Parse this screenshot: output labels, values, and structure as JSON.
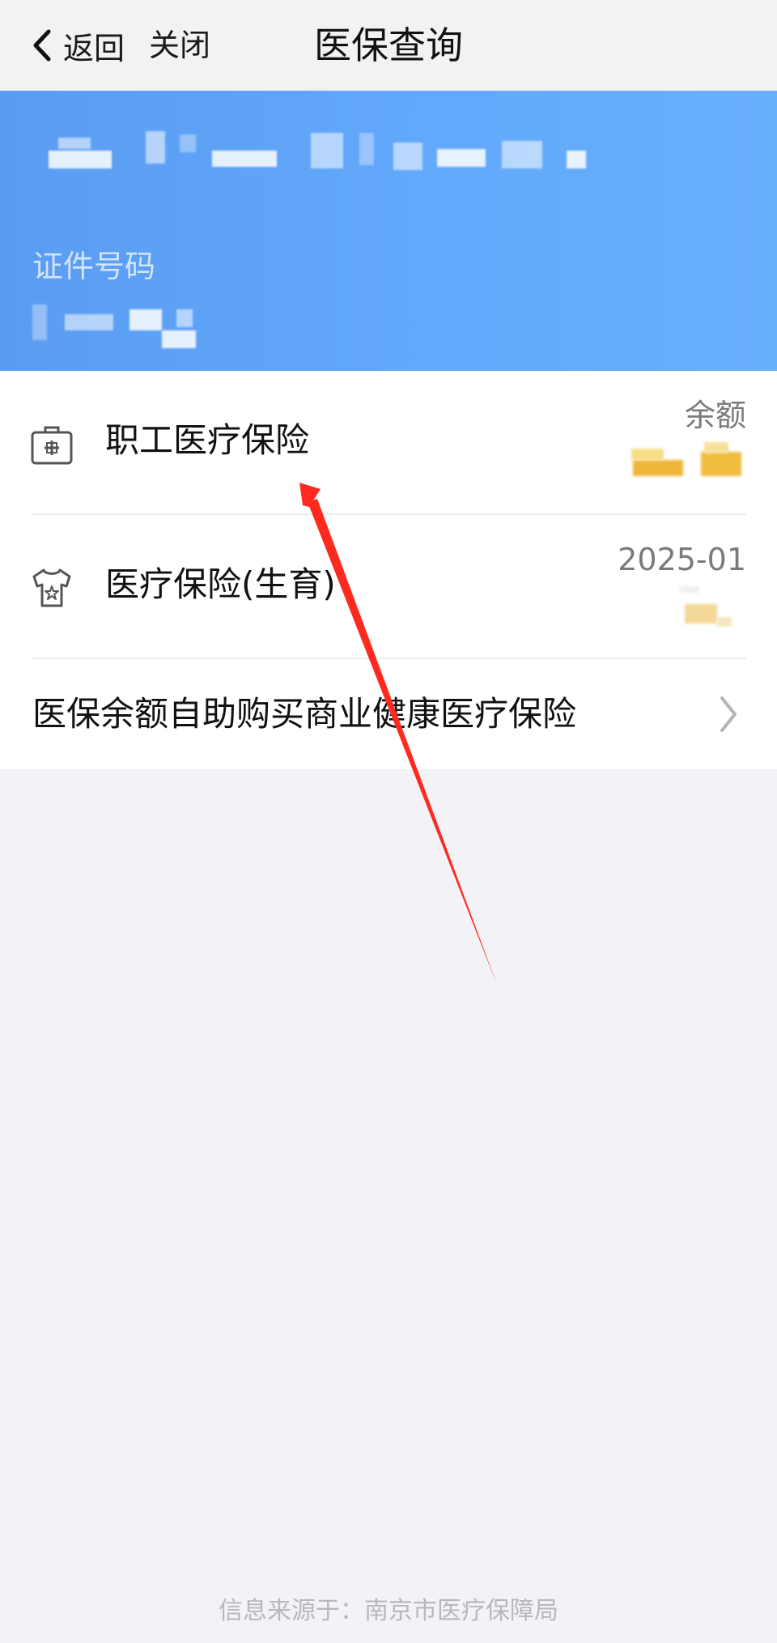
{
  "nav": {
    "back_label": "返回",
    "close_label": "关闭",
    "title": "医保查询"
  },
  "header": {
    "id_label": "证件号码"
  },
  "list": {
    "items": [
      {
        "title": "职工医疗保险",
        "meta": "余额",
        "icon": "medical-kit-icon"
      },
      {
        "title": "医疗保险(生育)",
        "meta": "2025-01",
        "icon": "baby-clothes-icon"
      },
      {
        "title": "医保余额自助购买商业健康医疗保险",
        "icon": "chevron-right-icon"
      }
    ]
  },
  "footer": {
    "source": "信息来源于：南京市医疗保障局"
  },
  "colors": {
    "header_blue": "#62a8fb",
    "annotation_red": "#ff2a1f"
  }
}
